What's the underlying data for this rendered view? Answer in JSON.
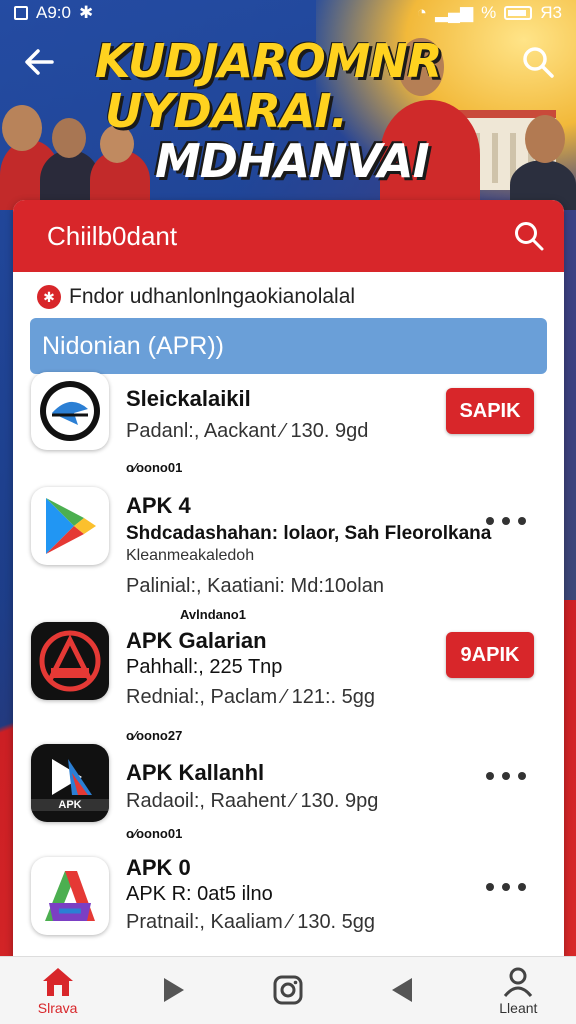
{
  "status_bar": {
    "time": "A9:0",
    "right_text": "%",
    "battery_text": "Я3"
  },
  "hero": {
    "line1": "KUDJAROMNR",
    "line2": "UYDARAI.",
    "line3": "MDHANVAI"
  },
  "card": {
    "title": "Chiilb0dant",
    "notice": "Fndor udhanlonlngaokianolalal",
    "filter": "Nidonian (APR))"
  },
  "apps": [
    {
      "name": "Sleickalaikil",
      "lines": [
        "Padanl:, Aackant ⁄ 130. 9gd"
      ],
      "action": "SAPIK",
      "tag": "o∕oono01"
    },
    {
      "name": "APK 4",
      "lines": [
        "Shdcadashahan: lolaor, Sah Fleorolkana",
        "Kleanmeakaledoh",
        "Palinial:, Kaatiani: Md:10olan"
      ],
      "action": "more",
      "tag": "Avlndano1"
    },
    {
      "name": "APK Galarian",
      "lines": [
        "Pahhall:, 225 Tnp",
        "Rednial:, Paclam ⁄ 121:. 5gg"
      ],
      "action": "9APIK",
      "tag": "o∕oono27"
    },
    {
      "name": "APK Kallanhl",
      "lines": [
        "Radaoil:, Raahent ⁄ 130. 9pg"
      ],
      "action": "more",
      "tag": "o∕oono01"
    },
    {
      "name": "APK 0",
      "lines": [
        "APK R: 0at5 ilno",
        "Pratnail:, Kaaliam ⁄ 130. 5gg"
      ],
      "action": "more",
      "tag": ""
    }
  ],
  "app4_icon_text": "APK",
  "bottom_nav": [
    {
      "label": "Slrava",
      "icon": "home-icon",
      "active": true
    },
    {
      "label": "",
      "icon": "play-icon",
      "active": false
    },
    {
      "label": "",
      "icon": "instagram-icon",
      "active": false
    },
    {
      "label": "",
      "icon": "back-triangle-icon",
      "active": false
    },
    {
      "label": "Lleant",
      "icon": "profile-icon",
      "active": false
    }
  ],
  "colors": {
    "accent": "#d8262a",
    "filter_bg": "#6a9fd8",
    "headline": "#ffd21f"
  }
}
